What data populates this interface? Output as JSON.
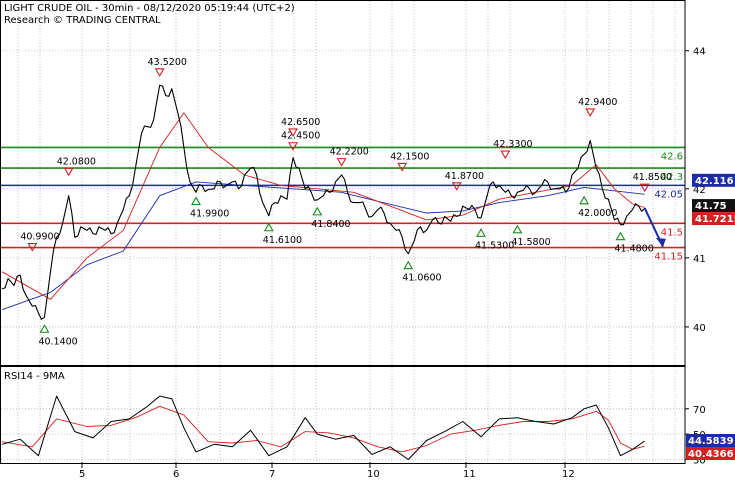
{
  "chart_data": {
    "type": "line",
    "title": "LIGHT CRUDE OIL - 30min - 08/12/2020 05:19:44 (UTC+2)",
    "subtitle": "Research © TRADING CENTRAL",
    "price_axis": {
      "ylim": [
        39.55,
        44.3
      ],
      "ticks": [
        40,
        41,
        42,
        44
      ]
    },
    "x_tick_labels": [
      "5",
      "6",
      "7",
      "10",
      "11",
      "12"
    ],
    "price_series": [
      [
        0,
        40.55
      ],
      [
        1,
        40.7
      ],
      [
        2,
        40.6
      ],
      [
        3,
        40.75
      ],
      [
        4,
        40.45
      ],
      [
        5,
        40.3
      ],
      [
        6,
        40.2
      ],
      [
        7,
        40.14
      ],
      [
        8,
        40.8
      ],
      [
        9,
        41.3
      ],
      [
        10,
        41.5
      ],
      [
        11,
        41.9
      ],
      [
        12,
        41.3
      ],
      [
        13,
        41.45
      ],
      [
        14,
        41.4
      ],
      [
        15,
        41.35
      ],
      [
        16,
        41.45
      ],
      [
        17,
        41.4
      ],
      [
        18,
        41.35
      ],
      [
        19,
        41.5
      ],
      [
        20,
        41.7
      ],
      [
        21,
        41.9
      ],
      [
        22,
        42.3
      ],
      [
        23,
        42.8
      ],
      [
        24,
        42.9
      ],
      [
        25,
        43.0
      ],
      [
        26,
        43.5
      ],
      [
        27,
        43.35
      ],
      [
        28,
        43.45
      ],
      [
        29,
        43.1
      ],
      [
        30,
        42.6
      ],
      [
        31,
        42.1
      ],
      [
        32,
        41.95
      ],
      [
        33,
        42.05
      ],
      [
        34,
        41.99
      ],
      [
        35,
        42.0
      ],
      [
        36,
        42.1
      ],
      [
        37,
        42.05
      ],
      [
        38,
        42.1
      ],
      [
        39,
        42.0
      ],
      [
        40,
        42.2
      ],
      [
        41,
        42.3
      ],
      [
        42,
        42.2
      ],
      [
        43,
        41.8
      ],
      [
        44,
        41.61
      ],
      [
        45,
        41.8
      ],
      [
        46,
        41.9
      ],
      [
        47,
        41.85
      ],
      [
        48,
        42.45
      ],
      [
        49,
        42.3
      ],
      [
        50,
        42.0
      ],
      [
        51,
        41.95
      ],
      [
        52,
        41.84
      ],
      [
        53,
        41.9
      ],
      [
        54,
        41.95
      ],
      [
        55,
        42.1
      ],
      [
        56,
        42.2
      ],
      [
        57,
        41.95
      ],
      [
        58,
        41.8
      ],
      [
        59,
        41.8
      ],
      [
        60,
        41.7
      ],
      [
        61,
        41.6
      ],
      [
        62,
        41.7
      ],
      [
        63,
        41.65
      ],
      [
        64,
        41.5
      ],
      [
        65,
        41.4
      ],
      [
        66,
        41.3
      ],
      [
        67,
        41.06
      ],
      [
        68,
        41.25
      ],
      [
        69,
        41.45
      ],
      [
        70,
        41.4
      ],
      [
        71,
        41.55
      ],
      [
        72,
        41.5
      ],
      [
        73,
        41.6
      ],
      [
        74,
        41.53
      ],
      [
        75,
        41.6
      ],
      [
        76,
        41.75
      ],
      [
        77,
        41.7
      ],
      [
        78,
        41.7
      ],
      [
        79,
        41.58
      ],
      [
        80,
        41.9
      ],
      [
        81,
        42.1
      ],
      [
        82,
        42.05
      ],
      [
        83,
        41.95
      ],
      [
        84,
        41.9
      ],
      [
        85,
        41.95
      ],
      [
        86,
        41.98
      ],
      [
        87,
        42.0
      ],
      [
        88,
        41.95
      ],
      [
        89,
        42.05
      ],
      [
        90,
        42.1
      ],
      [
        91,
        42.0
      ],
      [
        92,
        42.0
      ],
      [
        93,
        41.95
      ],
      [
        94,
        42.2
      ],
      [
        95,
        42.3
      ],
      [
        96,
        42.5
      ],
      [
        97,
        42.7
      ],
      [
        98,
        42.3
      ],
      [
        99,
        42.0
      ],
      [
        100,
        41.85
      ],
      [
        101,
        41.55
      ],
      [
        102,
        41.48
      ],
      [
        103,
        41.6
      ],
      [
        104,
        41.7
      ],
      [
        105,
        41.75
      ],
      [
        106,
        41.72
      ]
    ],
    "ma_red_series": [
      [
        0,
        40.8
      ],
      [
        8,
        40.4
      ],
      [
        14,
        41.0
      ],
      [
        20,
        41.4
      ],
      [
        26,
        42.6
      ],
      [
        30,
        43.1
      ],
      [
        34,
        42.6
      ],
      [
        40,
        42.2
      ],
      [
        46,
        42.05
      ],
      [
        52,
        42.0
      ],
      [
        58,
        41.95
      ],
      [
        64,
        41.75
      ],
      [
        70,
        41.55
      ],
      [
        76,
        41.62
      ],
      [
        82,
        41.85
      ],
      [
        88,
        41.95
      ],
      [
        94,
        42.05
      ],
      [
        98,
        42.35
      ],
      [
        101,
        42.0
      ],
      [
        104,
        41.78
      ],
      [
        106,
        41.73
      ]
    ],
    "ma_blue_series": [
      [
        0,
        40.25
      ],
      [
        8,
        40.5
      ],
      [
        14,
        40.9
      ],
      [
        20,
        41.1
      ],
      [
        26,
        41.9
      ],
      [
        32,
        42.1
      ],
      [
        40,
        42.05
      ],
      [
        48,
        42.0
      ],
      [
        56,
        41.95
      ],
      [
        62,
        41.82
      ],
      [
        70,
        41.65
      ],
      [
        76,
        41.68
      ],
      [
        82,
        41.8
      ],
      [
        90,
        41.9
      ],
      [
        96,
        42.02
      ],
      [
        100,
        41.98
      ],
      [
        106,
        41.92
      ]
    ],
    "levels": [
      {
        "value": 42.6,
        "label": "42.6",
        "color": "#1a8a1a"
      },
      {
        "value": 42.3,
        "label": "42.3",
        "color": "#1a8a1a"
      },
      {
        "value": 42.05,
        "label": "42.05",
        "color": "#1c2ba8"
      },
      {
        "value": 41.5,
        "label": "41.5",
        "color": "#d32020"
      },
      {
        "value": 41.15,
        "label": "41.15",
        "color": "#d32020"
      }
    ],
    "annotations": [
      {
        "i": 5,
        "price": 40.99,
        "label": "40.9900",
        "kind": "high"
      },
      {
        "i": 7,
        "price": 40.14,
        "label": "40.1400",
        "kind": "low"
      },
      {
        "i": 11,
        "price": 42.08,
        "label": "42.0800",
        "kind": "high"
      },
      {
        "i": 26,
        "price": 43.52,
        "label": "43.5200",
        "kind": "high"
      },
      {
        "i": 32,
        "price": 41.99,
        "label": "41.9900",
        "kind": "low"
      },
      {
        "i": 44,
        "price": 41.61,
        "label": "41.6100",
        "kind": "low"
      },
      {
        "i": 48,
        "price": 42.45,
        "label": "42.4500",
        "kind": "high"
      },
      {
        "i": 48,
        "price": 42.65,
        "label": "42.6500",
        "kind": "high"
      },
      {
        "i": 52,
        "price": 41.84,
        "label": "41.8400",
        "kind": "low"
      },
      {
        "i": 56,
        "price": 42.22,
        "label": "42.2200",
        "kind": "high"
      },
      {
        "i": 66,
        "price": 42.15,
        "label": "42.1500",
        "kind": "high"
      },
      {
        "i": 67,
        "price": 41.06,
        "label": "41.0600",
        "kind": "low"
      },
      {
        "i": 75,
        "price": 41.87,
        "label": "41.8700",
        "kind": "high"
      },
      {
        "i": 79,
        "price": 41.53,
        "label": "41.5300",
        "kind": "low"
      },
      {
        "i": 83,
        "price": 42.33,
        "label": "42.3300",
        "kind": "high"
      },
      {
        "i": 85,
        "price": 41.58,
        "label": "41.5800",
        "kind": "low"
      },
      {
        "i": 96,
        "price": 42.0,
        "label": "42.0000",
        "kind": "low"
      },
      {
        "i": 97,
        "price": 42.94,
        "label": "42.9400",
        "kind": "high"
      },
      {
        "i": 102,
        "price": 41.48,
        "label": "41.4800",
        "kind": "low"
      },
      {
        "i": 106,
        "price": 41.85,
        "label": "41.8500",
        "kind": "high"
      }
    ],
    "forecast_arrow": {
      "from": [
        106,
        41.72
      ],
      "to": [
        109,
        41.16
      ],
      "color": "#1c2ba8"
    },
    "price_badges": [
      {
        "value": 42.116,
        "label": "42.116",
        "bg": "#1c2ba8",
        "fg": "#ffffff"
      },
      {
        "value": 41.75,
        "label": "41.75",
        "bg": "#111111",
        "fg": "#ffffff"
      },
      {
        "value": 41.7215,
        "label": "41.7215",
        "bg": "#d32020",
        "fg": "#ffffff"
      }
    ],
    "rsi": {
      "title": "RSI14 - 9MA",
      "ylim": [
        28,
        88
      ],
      "ticks": [
        30,
        50,
        70
      ],
      "rsi_series": [
        [
          0,
          42
        ],
        [
          3,
          46
        ],
        [
          6,
          33
        ],
        [
          9,
          80
        ],
        [
          12,
          52
        ],
        [
          15,
          47
        ],
        [
          18,
          60
        ],
        [
          21,
          62
        ],
        [
          24,
          72
        ],
        [
          26,
          80
        ],
        [
          28,
          78
        ],
        [
          30,
          55
        ],
        [
          32,
          36
        ],
        [
          35,
          42
        ],
        [
          38,
          40
        ],
        [
          41,
          53
        ],
        [
          44,
          33
        ],
        [
          47,
          40
        ],
        [
          50,
          63
        ],
        [
          52,
          50
        ],
        [
          55,
          46
        ],
        [
          58,
          49
        ],
        [
          61,
          34
        ],
        [
          64,
          40
        ],
        [
          67,
          30
        ],
        [
          70,
          45
        ],
        [
          73,
          52
        ],
        [
          76,
          60
        ],
        [
          79,
          48
        ],
        [
          82,
          62
        ],
        [
          85,
          63
        ],
        [
          88,
          60
        ],
        [
          91,
          58
        ],
        [
          94,
          63
        ],
        [
          96,
          70
        ],
        [
          98,
          73
        ],
        [
          100,
          55
        ],
        [
          102,
          33
        ],
        [
          104,
          38
        ],
        [
          106,
          44.58
        ]
      ],
      "ma_series": [
        [
          0,
          44
        ],
        [
          5,
          40
        ],
        [
          9,
          62
        ],
        [
          14,
          56
        ],
        [
          18,
          57
        ],
        [
          22,
          63
        ],
        [
          26,
          72
        ],
        [
          30,
          65
        ],
        [
          34,
          44
        ],
        [
          38,
          43
        ],
        [
          42,
          45
        ],
        [
          46,
          40
        ],
        [
          50,
          52
        ],
        [
          54,
          51
        ],
        [
          58,
          47
        ],
        [
          62,
          40
        ],
        [
          66,
          36
        ],
        [
          70,
          41
        ],
        [
          74,
          50
        ],
        [
          78,
          53
        ],
        [
          82,
          57
        ],
        [
          86,
          60
        ],
        [
          90,
          60
        ],
        [
          94,
          62
        ],
        [
          98,
          68
        ],
        [
          100,
          61
        ],
        [
          102,
          43
        ],
        [
          104,
          38
        ],
        [
          106,
          40.44
        ]
      ],
      "badges": [
        {
          "value": 44.5839,
          "label": "44.5839",
          "bg": "#1c2ba8",
          "fg": "#ffffff"
        },
        {
          "value": 40.4366,
          "label": "40.4366",
          "bg": "#d32020",
          "fg": "#ffffff"
        }
      ]
    }
  }
}
